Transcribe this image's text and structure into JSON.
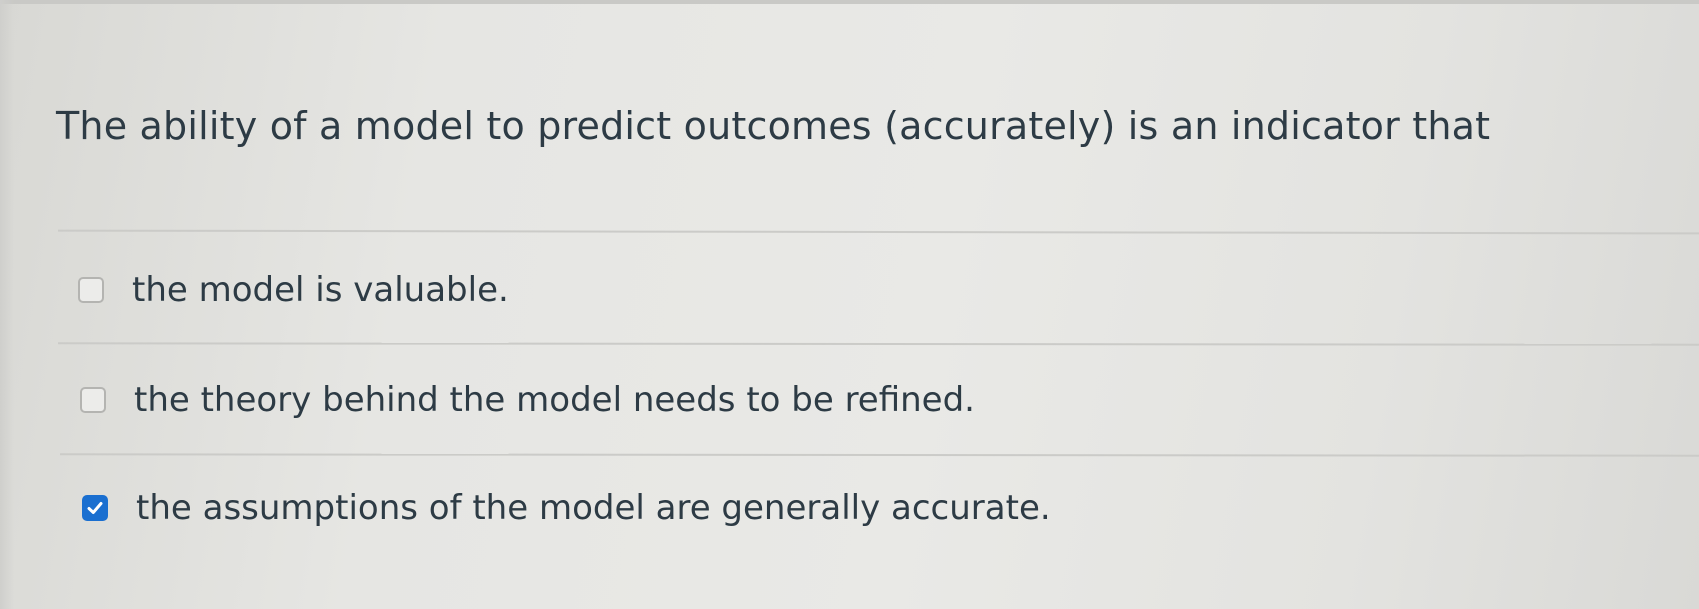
{
  "question": {
    "text": "The ability of a model to predict outcomes (accurately) is an indicator that"
  },
  "options": [
    {
      "label": "the model is valuable.",
      "checked": false
    },
    {
      "label": "the theory behind the model needs to be refined.",
      "checked": false
    },
    {
      "label": "the assumptions of the model are generally accurate.",
      "checked": true
    }
  ],
  "colors": {
    "text": "#2d3b45",
    "checkbox_checked": "#1a6fd0",
    "checkbox_border": "#b4b4b1",
    "divider": "#cbcbc8"
  },
  "icons": {
    "checked_mark": "check-icon"
  }
}
